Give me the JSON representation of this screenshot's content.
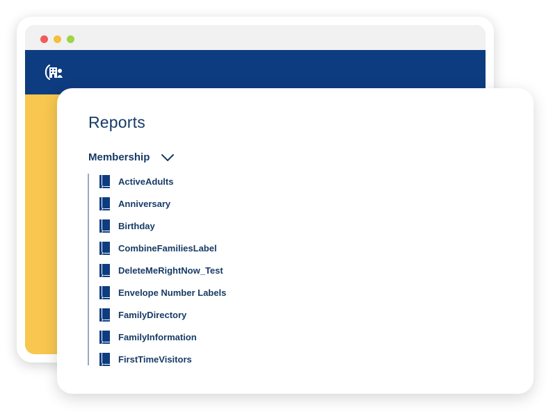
{
  "window": {
    "controls": [
      "close",
      "minimize",
      "maximize"
    ],
    "header_logo_icon": "church-building-icon"
  },
  "page": {
    "title": "Reports"
  },
  "section": {
    "label": "Membership",
    "expanded": true,
    "toggle_icon": "chevron-down-icon"
  },
  "reports": [
    {
      "label": "ActiveAdults",
      "icon": "book-icon"
    },
    {
      "label": "Anniversary",
      "icon": "book-icon"
    },
    {
      "label": "Birthday",
      "icon": "book-icon"
    },
    {
      "label": "CombineFamiliesLabel",
      "icon": "book-icon"
    },
    {
      "label": "DeleteMeRightNow_Test",
      "icon": "book-icon"
    },
    {
      "label": "Envelope Number Labels",
      "icon": "book-icon"
    },
    {
      "label": "FamilyDirectory",
      "icon": "book-icon"
    },
    {
      "label": "FamilyInformation",
      "icon": "book-icon"
    },
    {
      "label": "FirstTimeVisitors",
      "icon": "book-icon"
    }
  ],
  "colors": {
    "header_blue": "#0e3c80",
    "accent_yellow": "#f8c74f",
    "text_navy": "#173b66"
  }
}
